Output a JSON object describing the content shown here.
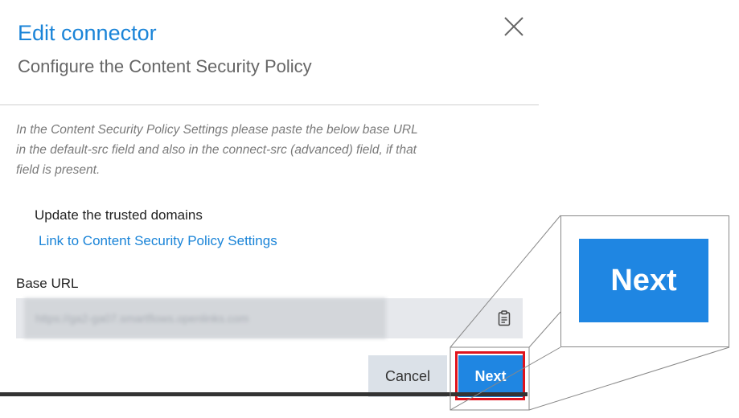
{
  "dialog": {
    "title": "Edit connector",
    "subtitle": "Configure the Content Security Policy",
    "close_icon": "close-icon"
  },
  "instructions": {
    "line1": "In the Content Security Policy Settings please paste the below base URL",
    "line2": "in the default-src field and also in the connect-src (advanced) field, if that",
    "line3": "field is present."
  },
  "trusted_domains": {
    "label": "Update the trusted domains",
    "link_text": "Link to Content Security Policy Settings"
  },
  "base_url": {
    "label": "Base URL",
    "value": "https://ga2-ga07.smartflows.openlinks.com",
    "copy_icon": "clipboard-icon"
  },
  "actions": {
    "cancel_label": "Cancel",
    "next_label": "Next"
  },
  "zoom": {
    "next_label": "Next"
  },
  "colors": {
    "accent": "#1f86e2",
    "title": "#1a84d8",
    "highlight": "#e0141e",
    "cancel_bg": "#dbe1e8"
  }
}
